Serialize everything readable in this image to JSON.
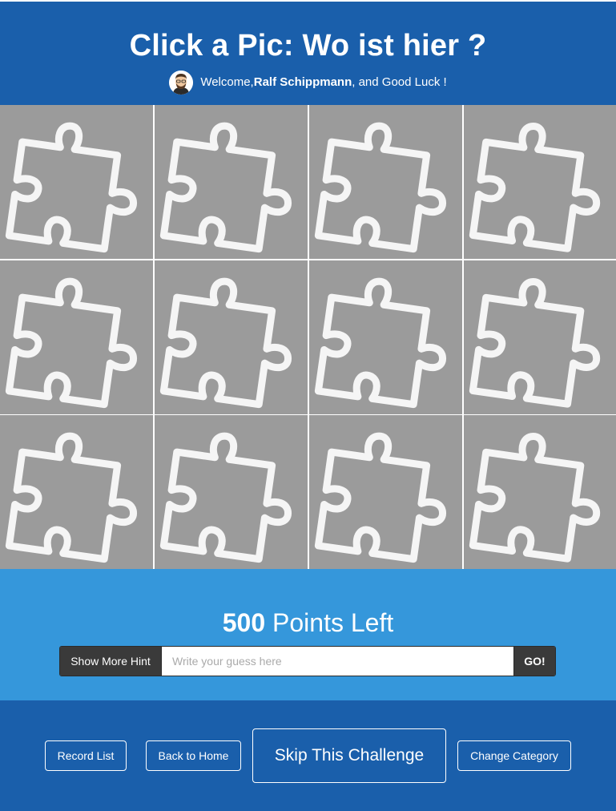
{
  "header": {
    "title": "Click a Pic: Wo ist hier ?",
    "welcome_prefix": "Welcome, ",
    "user_name": "Ralf Schippmann",
    "welcome_suffix": ", and Good Luck !"
  },
  "grid": {
    "tile_icon": "puzzle-piece-icon",
    "rows": 3,
    "columns": 4,
    "tile_color": "#9b9b9b"
  },
  "points": {
    "value": "500",
    "label": " Points Left"
  },
  "guess": {
    "hint_button": "Show More Hint",
    "placeholder": "Write your guess here",
    "value": "",
    "go_button": "GO!"
  },
  "footer": {
    "record_list": "Record List",
    "back_home": "Back to Home",
    "skip": "Skip This Challenge",
    "change_category": "Change Category"
  },
  "colors": {
    "header_bg": "#1a5fab",
    "points_bg": "#3597db",
    "footer_bg": "#1a5fab",
    "button_dark": "#3a3a3a"
  }
}
